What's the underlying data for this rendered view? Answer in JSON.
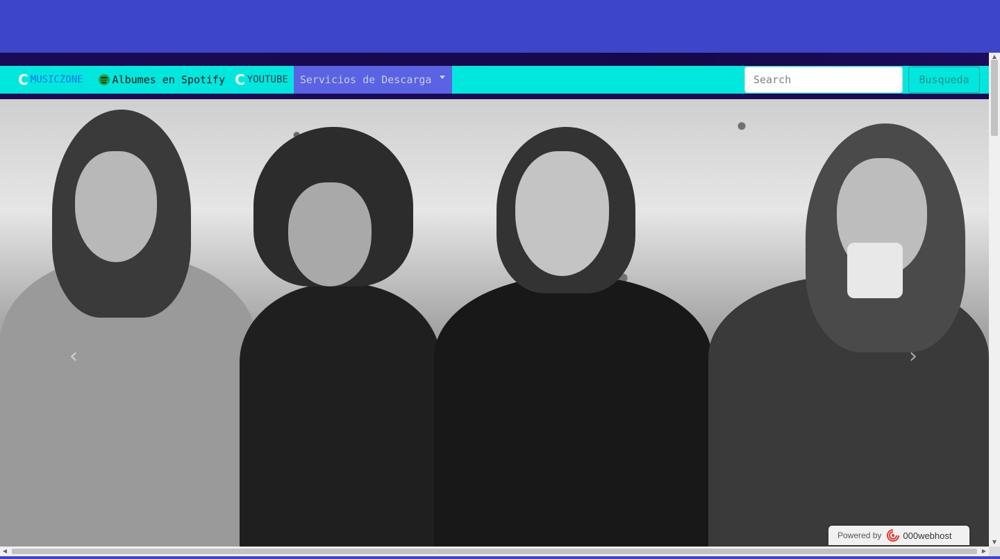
{
  "navbar": {
    "brand_label": "MUSICZONE",
    "brand_icon": "C",
    "spotify_label": "Albumes en Spotify",
    "youtube_label": "YOUTUBE",
    "youtube_icon": "C",
    "dropdown_label": "Servicios de Descarga",
    "colors": {
      "navbar_bg": "#00e8de",
      "dropdown_bg": "#5a63e3",
      "brand_text": "#1e6fe8"
    }
  },
  "search": {
    "placeholder": "Search",
    "value": "",
    "button_label": "Busqueda"
  },
  "carousel": {
    "prev_icon": "chevron-left-icon",
    "next_icon": "chevron-right-icon",
    "prev_glyph": "‹",
    "next_glyph": "›"
  },
  "footer_badge": {
    "prefix": "Powered by",
    "brand": "000webhost"
  },
  "page": {
    "header_bg": "#3d46c9"
  }
}
